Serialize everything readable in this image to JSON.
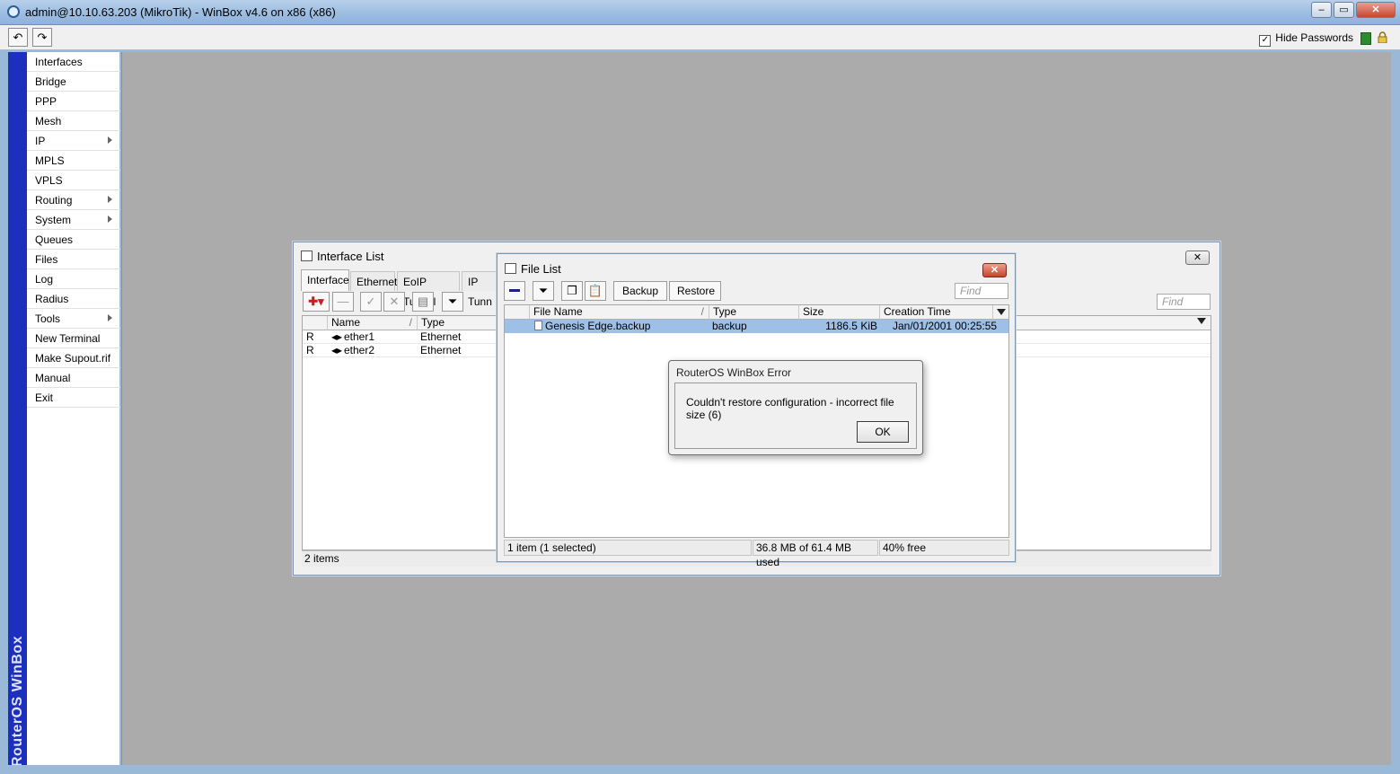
{
  "window": {
    "title": "admin@10.10.63.203 (MikroTik) - WinBox v4.6 on x86 (x86)"
  },
  "toolbar": {
    "undo": "↶",
    "redo": "↷",
    "hide_passwords": "Hide Passwords",
    "hide_passwords_checked": true
  },
  "brand": "RouterOS WinBox",
  "menu": [
    {
      "label": "Interfaces",
      "submenu": false
    },
    {
      "label": "Bridge",
      "submenu": false
    },
    {
      "label": "PPP",
      "submenu": false
    },
    {
      "label": "Mesh",
      "submenu": false
    },
    {
      "label": "IP",
      "submenu": true
    },
    {
      "label": "MPLS",
      "submenu": false
    },
    {
      "label": "VPLS",
      "submenu": false
    },
    {
      "label": "Routing",
      "submenu": true
    },
    {
      "label": "System",
      "submenu": true
    },
    {
      "label": "Queues",
      "submenu": false
    },
    {
      "label": "Files",
      "submenu": false
    },
    {
      "label": "Log",
      "submenu": false
    },
    {
      "label": "Radius",
      "submenu": false
    },
    {
      "label": "Tools",
      "submenu": true
    },
    {
      "label": "New Terminal",
      "submenu": false
    },
    {
      "label": "Make Supout.rif",
      "submenu": false
    },
    {
      "label": "Manual",
      "submenu": false
    },
    {
      "label": "Exit",
      "submenu": false
    }
  ],
  "interface_list": {
    "title": "Interface List",
    "tabs": [
      "Interface",
      "Ethernet",
      "EoIP Tunnel",
      "IP Tunn"
    ],
    "find_placeholder": "Find",
    "columns": [
      "Name",
      "Type"
    ],
    "rows": [
      {
        "flag": "R",
        "name": "ether1",
        "type": "Ethernet"
      },
      {
        "flag": "R",
        "name": "ether2",
        "type": "Ethernet"
      }
    ],
    "status": "2 items"
  },
  "file_list": {
    "title": "File List",
    "backup_label": "Backup",
    "restore_label": "Restore",
    "find_placeholder": "Find",
    "columns": [
      "File Name",
      "Type",
      "Size",
      "Creation Time"
    ],
    "rows": [
      {
        "name": "Genesis Edge.backup",
        "type": "backup",
        "size": "1186.5 KiB",
        "created": "Jan/01/2001 00:25:55",
        "selected": true
      }
    ],
    "status": [
      "1 item (1 selected)",
      "36.8 MB of 61.4 MB used",
      "40% free"
    ]
  },
  "error_dialog": {
    "title": "RouterOS WinBox Error",
    "message": "Couldn't restore configuration - incorrect file size (6)",
    "ok_label": "OK"
  }
}
